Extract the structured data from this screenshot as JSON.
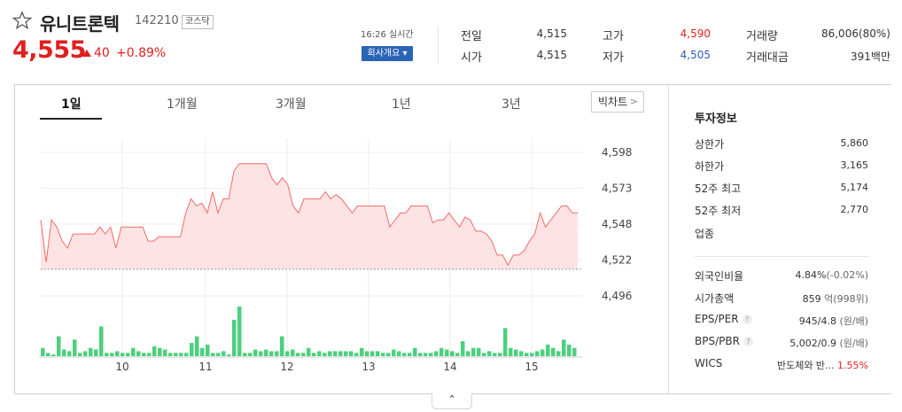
{
  "stock": {
    "name": "유니트론텍",
    "code": "142210",
    "market": "코스닥",
    "price": "4,555",
    "change": "40",
    "change_rate": "+0.89%",
    "time_label": "16:26 실시간",
    "company_button": "회사개요 ▾"
  },
  "quote": {
    "prev_label": "전일",
    "prev_value": "4,515",
    "open_label": "시가",
    "open_value": "4,515",
    "high_label": "고가",
    "high_value": "4,590",
    "low_label": "저가",
    "low_value": "4,505",
    "volume_label": "거래량",
    "volume_value": "86,006(80%)",
    "amount_label": "거래대금",
    "amount_value": "391백만"
  },
  "tabs": [
    "1일",
    "1개월",
    "3개월",
    "1년",
    "3년"
  ],
  "bigchart_label": "빅차트",
  "colors": {
    "up": "#e01f1f",
    "down": "#2d5bb9",
    "volume": "#4cd07d",
    "line": "#f06b6b",
    "fill": "#fde3e3"
  },
  "info": {
    "title": "투자정보",
    "upper_label": "상한가",
    "upper_value": "5,860",
    "lower_label": "하한가",
    "lower_value": "3,165",
    "high52_label": "52주 최고",
    "high52_value": "5,174",
    "low52_label": "52주 최저",
    "low52_value": "2,770",
    "sector_label": "업종",
    "foreign_label": "외국인비율",
    "foreign_value": "4.84%",
    "foreign_change": "(-0.02%)",
    "mcap_label": "시가총액",
    "mcap_value": "859",
    "mcap_unit": "억(998위)",
    "eps_label": "EPS/PER",
    "eps_value": "945/4.8",
    "eps_unit": "(원/배)",
    "bps_label": "BPS/PBR",
    "bps_value": "5,002/0.9",
    "bps_unit": "(원/배)",
    "wics_label": "WICS",
    "wics_value": "반도체와 반...",
    "wics_rate": "1.55%"
  },
  "chart_data": {
    "type": "line",
    "y_ticks": [
      "4,598",
      "4,573",
      "4,548",
      "4,522",
      "4,496"
    ],
    "x_ticks": [
      "10",
      "11",
      "12",
      "13",
      "14",
      "15"
    ],
    "ylim": [
      4496,
      4598
    ],
    "prev_close": 4515,
    "price_series": [
      4550,
      4520,
      4550,
      4545,
      4535,
      4530,
      4540,
      4540,
      4540,
      4540,
      4540,
      4545,
      4540,
      4545,
      4530,
      4545,
      4545,
      4545,
      4545,
      4545,
      4535,
      4535,
      4538,
      4538,
      4538,
      4538,
      4538,
      4555,
      4565,
      4560,
      4562,
      4555,
      4570,
      4555,
      4565,
      4565,
      4585,
      4590,
      4590,
      4590,
      4590,
      4590,
      4590,
      4580,
      4575,
      4580,
      4575,
      4560,
      4555,
      4565,
      4565,
      4565,
      4565,
      4570,
      4565,
      4568,
      4565,
      4560,
      4555,
      4560,
      4560,
      4560,
      4560,
      4560,
      4560,
      4545,
      4550,
      4555,
      4555,
      4560,
      4560,
      4560,
      4560,
      4548,
      4550,
      4550,
      4555,
      4550,
      4545,
      4552,
      4550,
      4542,
      4542,
      4540,
      4535,
      4525,
      4525,
      4518,
      4525,
      4525,
      4528,
      4535,
      4540,
      4555,
      4545,
      4550,
      4555,
      4560,
      4560,
      4555,
      4555
    ],
    "volume_series": [
      5,
      2,
      1,
      12,
      4,
      3,
      10,
      2,
      3,
      5,
      4,
      18,
      2,
      2,
      3,
      2,
      2,
      5,
      3,
      2,
      2,
      6,
      5,
      4,
      2,
      2,
      2,
      2,
      8,
      12,
      5,
      7,
      2,
      2,
      3,
      1,
      22,
      30,
      2,
      2,
      4,
      3,
      4,
      3,
      3,
      12,
      3,
      4,
      2,
      2,
      5,
      2,
      3,
      2,
      3,
      3,
      3,
      3,
      3,
      2,
      5,
      3,
      3,
      3,
      2,
      2,
      4,
      3,
      2,
      2,
      5,
      2,
      2,
      2,
      3,
      5,
      4,
      3,
      2,
      9,
      3,
      5,
      5,
      2,
      3,
      2,
      2,
      17,
      5,
      4,
      3,
      2,
      2,
      3,
      4,
      7,
      5,
      3,
      10,
      7,
      5
    ]
  }
}
